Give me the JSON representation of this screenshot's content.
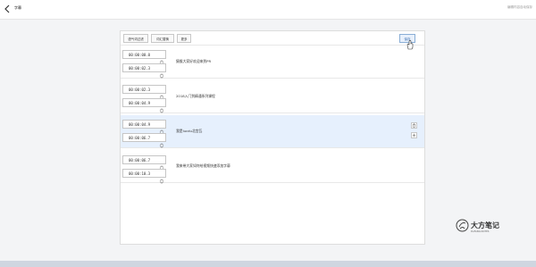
{
  "header": {
    "title": "字幕",
    "hint": "编辑内容自动保存"
  },
  "toolbar": {
    "buttons": [
      "语气词过滤",
      "词汇替换",
      "更多"
    ],
    "save_label": "保存"
  },
  "segments": [
    {
      "start": "00:00:00.0",
      "end": "00:00:02.3",
      "text": "猿猴大家好欢迎来到PR"
    },
    {
      "start": "00:00:02.3",
      "end": "00:00:04.9",
      "text": "2018入门到精通系列课程"
    },
    {
      "start": "00:00:04.9",
      "end": "00:00:06.7",
      "text": "我是lucdu北宫瓦"
    },
    {
      "start": "00:00:06.7",
      "end": "00:00:10.3",
      "text": "我来带大家如何给视频快速添加字幕"
    }
  ],
  "logo": {
    "title": "大方笔记",
    "subtitle": "DAFANG NOTES"
  },
  "colors": {
    "active_row": "#e6f0fd",
    "save_accent": "#3a6fb0"
  }
}
